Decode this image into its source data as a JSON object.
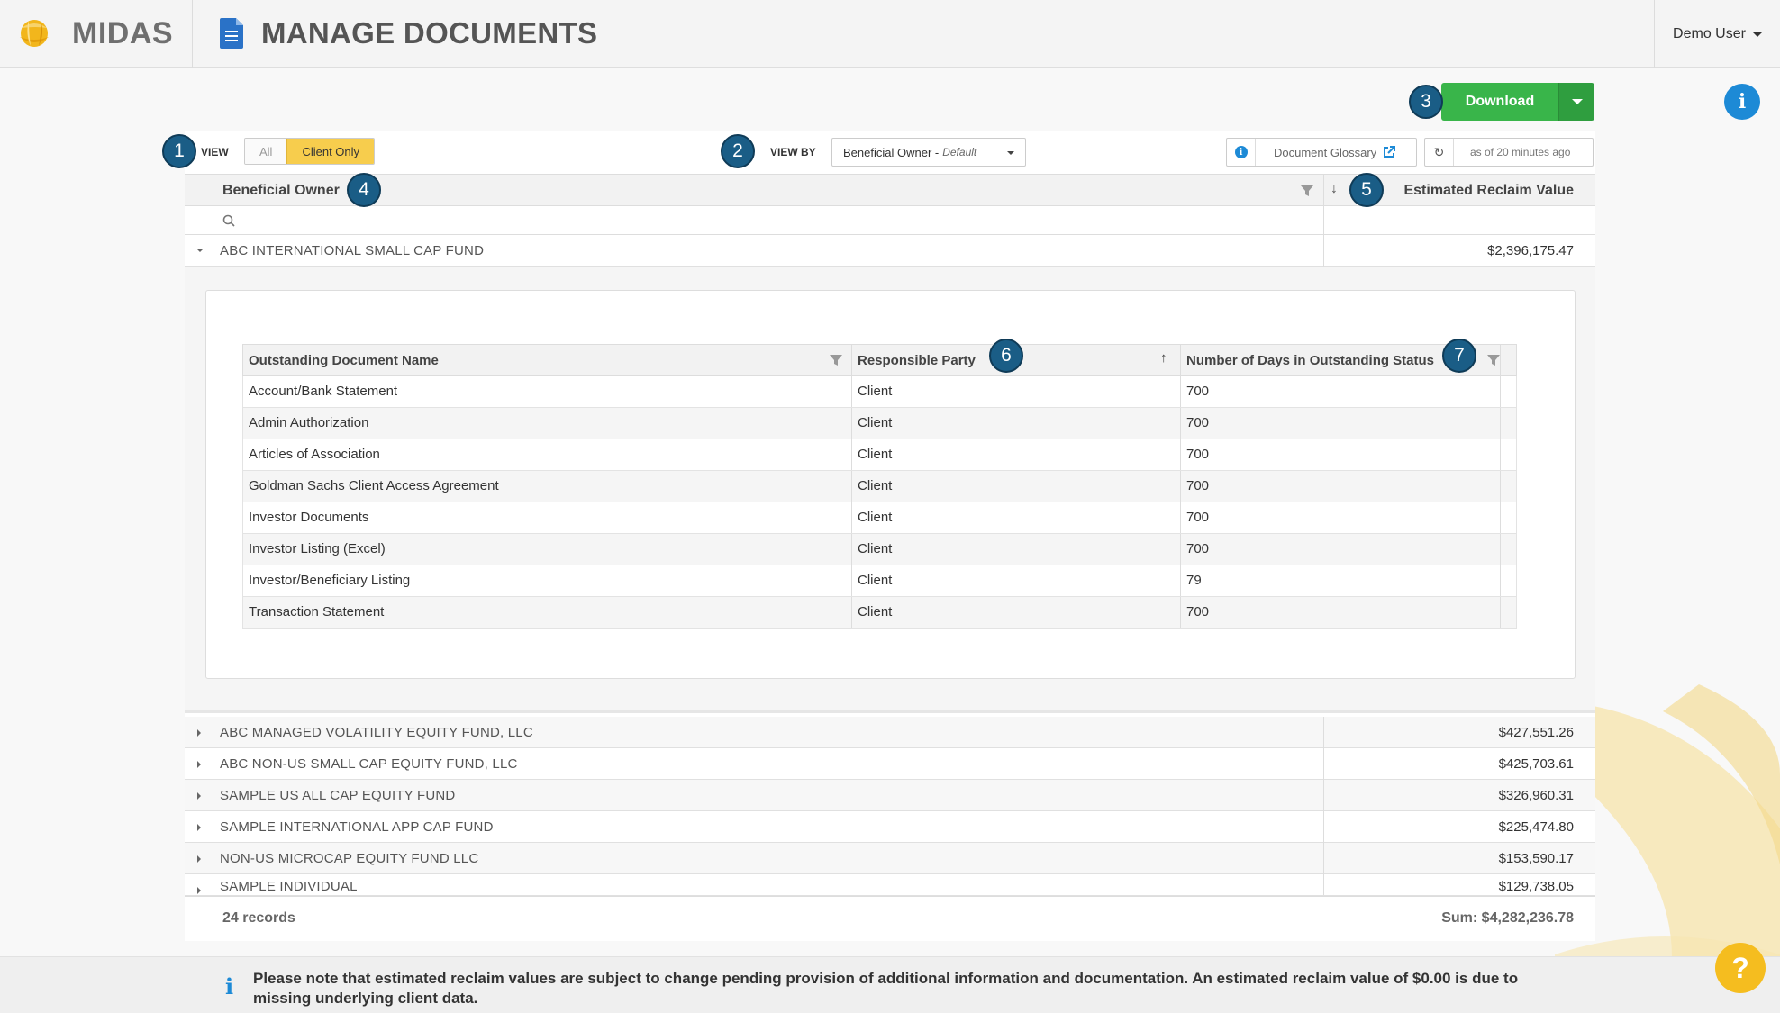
{
  "app": {
    "brand": "MIDAS",
    "page_title": "MANAGE DOCUMENTS",
    "user": "Demo User"
  },
  "badges": [
    "1",
    "2",
    "3",
    "4",
    "5",
    "6",
    "7"
  ],
  "actions": {
    "download_label": "Download"
  },
  "toolbar": {
    "view_label": "VIEW",
    "view_options": [
      "All",
      "Client Only"
    ],
    "view_selected": "Client Only",
    "viewby_label": "VIEW BY",
    "viewby_value": "Beneficial Owner -",
    "viewby_suffix": "Default",
    "glossary_label": "Document Glossary",
    "refresh_text": "as of 20 minutes ago"
  },
  "grid": {
    "columns": [
      "Beneficial Owner",
      "Estimated Reclaim Value"
    ],
    "expanded_row": {
      "name": "ABC INTERNATIONAL SMALL CAP FUND",
      "value": "$2,396,175.47"
    },
    "sub_grid": {
      "columns": [
        "Outstanding Document Name",
        "Responsible Party",
        "Number of Days in Outstanding Status"
      ],
      "rows": [
        [
          "Account/Bank Statement",
          "Client",
          "700"
        ],
        [
          "Admin Authorization",
          "Client",
          "700"
        ],
        [
          "Articles of Association",
          "Client",
          "700"
        ],
        [
          "Goldman Sachs Client Access Agreement",
          "Client",
          "700"
        ],
        [
          "Investor Documents",
          "Client",
          "700"
        ],
        [
          "Investor Listing (Excel)",
          "Client",
          "700"
        ],
        [
          "Investor/Beneficiary Listing",
          "Client",
          "79"
        ],
        [
          "Transaction Statement",
          "Client",
          "700"
        ]
      ]
    },
    "rows": [
      {
        "name": "ABC MANAGED VOLATILITY EQUITY FUND, LLC",
        "value": "$427,551.26"
      },
      {
        "name": "ABC NON-US SMALL CAP EQUITY FUND, LLC",
        "value": "$425,703.61"
      },
      {
        "name": "SAMPLE US ALL CAP EQUITY FUND",
        "value": "$326,960.31"
      },
      {
        "name": "SAMPLE INTERNATIONAL APP CAP FUND",
        "value": "$225,474.80"
      },
      {
        "name": "NON-US MICROCAP EQUITY FUND LLC",
        "value": "$153,590.17"
      },
      {
        "name": "SAMPLE INDIVIDUAL",
        "value": "$129,738.05"
      }
    ],
    "footer_count": "24 records",
    "footer_sum": "Sum: $4,282,236.78"
  },
  "notice": "Please note that estimated reclaim values are subject to change pending provision of additional information and documentation. An estimated reclaim value of $0.00 is due to missing underlying client data.",
  "help_label": "?",
  "colors": {
    "accent_green": "#39b54a",
    "accent_yellow": "#f7cd4d",
    "badge_blue": "#1a5d86",
    "info_blue": "#1d8ad6"
  }
}
